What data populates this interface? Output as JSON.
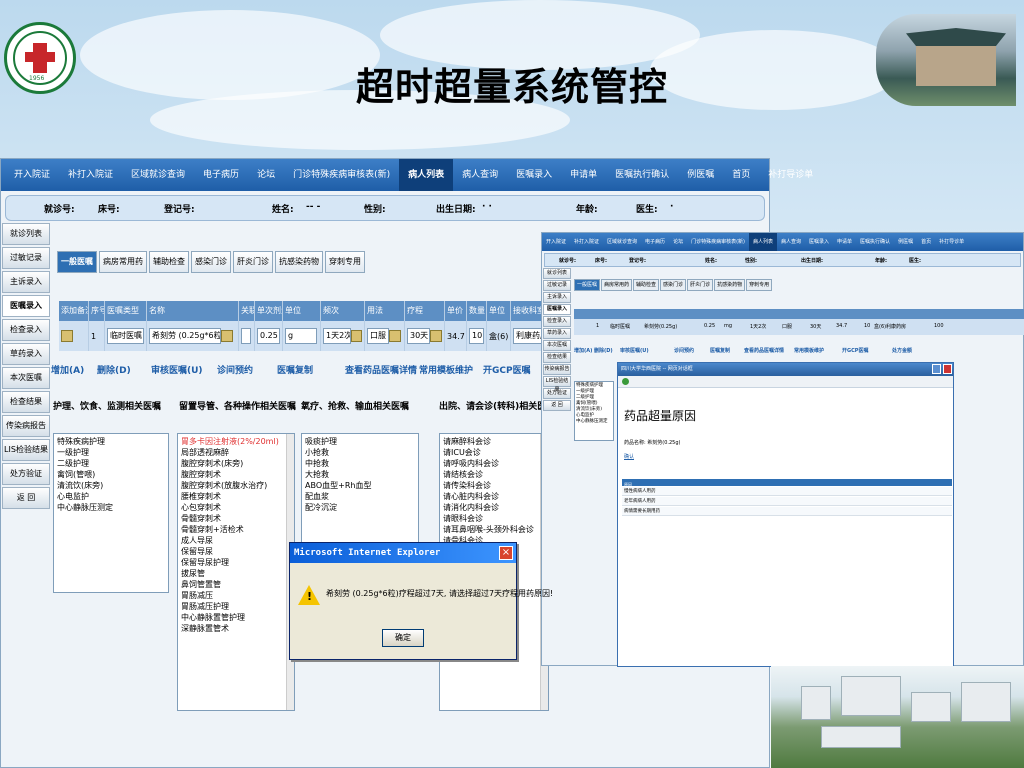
{
  "slide": {
    "title": "超时超量系统管控",
    "logo_text": "1956"
  },
  "app": {
    "nav": [
      "开入院证",
      "补打入院证",
      "区域就诊查询",
      "电子病历",
      "论坛",
      "门诊特殊疾病审核表(新)",
      "病人列表",
      "病人查询",
      "医嘱录入",
      "申请单",
      "医嘱执行确认",
      "例医嘱",
      "首页",
      "补打导诊单"
    ],
    "nav_active_index": 6,
    "info": {
      "clinic_no_label": "就诊号:",
      "bed_label": "床号:",
      "reg_label": "登记号:",
      "name_label": "姓名:",
      "name_value": "-- -",
      "sex_label": "性别:",
      "dob_label": "出生日期:",
      "dob_value": "· ·",
      "age_label": "年龄:",
      "doctor_label": "医生:",
      "doctor_value": "·"
    },
    "left_menu": [
      "就诊列表",
      "过敏记录",
      "主诉录入",
      "医嘱录入",
      "检查录入",
      "草药录入",
      "本次医嘱",
      "检查结果",
      "传染病报告",
      "LIS检验结果",
      "处方验证",
      "返 回"
    ],
    "left_menu_selected": 3,
    "tabs": [
      "一般医嘱",
      "病房常用药",
      "辅助检查",
      "感染门诊",
      "肝炎门诊",
      "抗感染药物",
      "穿刺专用"
    ],
    "grid_headers": [
      "添加备注",
      "序号",
      "医嘱类型",
      "名称",
      "关联",
      "单次剂量",
      "单位",
      "频次",
      "用法",
      "疗程",
      "单价",
      "数量",
      "单位",
      "接收科室"
    ],
    "row": {
      "seq": "1",
      "type": "临时医嘱",
      "name": "希刻劳 (0.25g*6粒)",
      "dose": "0.25",
      "unit": "g",
      "freq": "1天2次",
      "route": "口服",
      "course": "30天",
      "price": "34.7",
      "qty": "10",
      "pack": "盒(6)",
      "dept": "利康药房"
    },
    "ops": [
      "增加(A)",
      "删除(D)",
      "审核医嘱(U)",
      "诊间预约",
      "医嘱复制",
      "查看药品医嘱详情",
      "常用模板维护",
      "开GCP医嘱"
    ],
    "col_headers": [
      "护理、饮食、监测相关医嘱",
      "留置导管、各种操作相关医嘱",
      "氧疗、抢救、输血相关医嘱",
      "出院、请会诊(转科)相关医嘱"
    ],
    "list1": [
      "特殊疾病护理",
      "一级护理",
      "二级护理",
      "禽饲(管喂)",
      "清流饮(床旁)",
      "心电监护",
      "中心静脉压测定"
    ],
    "list2": [
      "胃多卡因注射液(2%/20ml)",
      "局部透视麻醉",
      "腹腔穿刺术(床旁)",
      "腹腔穿刺术",
      "腹腔穿刺术(放腹水治疗)",
      "腰椎穿刺术",
      "心包穿刺术",
      "骨髓穿刺术",
      "骨髓穿刺+活检术",
      "成人导尿",
      "保留导尿",
      "保留导尿护理",
      "拔尿管",
      "鼻饲管置管",
      "胃肠减压",
      "胃肠减压护理",
      "中心静脉置管护理",
      "深静脉置管术"
    ],
    "list3": [
      "吸痰护理",
      "小抢救",
      "中抢救",
      "大抢救",
      "ABO血型+Rh血型",
      "配血浆",
      "配冷沉淀"
    ],
    "list4": [
      "请麻醉科会诊",
      "请ICU会诊",
      "请呼吸内科会诊",
      "请结核会诊",
      "请传染科会诊",
      "请心脏内科会诊",
      "请消化内科会诊",
      "请眼科会诊",
      "请耳鼻咽喉-头颈外科会诊",
      "请骨科会诊"
    ]
  },
  "dialog": {
    "title": "Microsoft Internet Explorer",
    "message": "希刻劳 (0.25g*6粒)疗程超过7天, 请选择超过7天疗程用药原因!",
    "ok": "确定"
  },
  "app2": {
    "nav": [
      "开入院证",
      "补打入院证",
      "区域就诊查询",
      "电子病历",
      "论坛",
      "门诊特殊疾病审核表(新)",
      "病人列表",
      "病人查询",
      "医嘱录入",
      "申请单",
      "医嘱执行确认",
      "例医嘱",
      "首页",
      "补打导诊单"
    ],
    "info": [
      "就诊号:",
      "床号:",
      "登记号:",
      "姓名:",
      "性别:",
      "出生日期:",
      "年龄:",
      "医生:"
    ],
    "left_menu": [
      "就诊列表",
      "过敏记录",
      "主诉录入",
      "医嘱录入",
      "检查录入",
      "草药录入",
      "本次医嘱",
      "检查结果",
      "传染病报告",
      "LIS检验结果",
      "处方验证",
      "返 回"
    ],
    "tabs": [
      "一般医嘱",
      "病房常用药",
      "辅助检查",
      "感染门诊",
      "肝炎门诊",
      "抗感染药物",
      "穿刺专用"
    ],
    "row_items": [
      "1",
      "临时医嘱",
      "希刻劳(0.25g)",
      "0.25",
      "mg",
      "1天2次",
      "口服",
      "30天",
      "34.7",
      "10",
      "盒(6)",
      "利康药房",
      "100"
    ],
    "ops": [
      "增加(A)",
      "删除(D)",
      "审核医嘱(U)",
      "诊间预约",
      "医嘱复制",
      "查看药品医嘱详情",
      "常用模板维护",
      "开GCP医嘱",
      "处方金额"
    ],
    "list": [
      "特殊疾病护理",
      "一级护理",
      "二级护理",
      "禽饲(管喂)",
      "清流饮(床旁)",
      "心电监护",
      "中心静脉压测定"
    ],
    "popup_title": "四川大学华西医院 -- 网页对话框",
    "popup_heading": "药品超量原因",
    "popup_drug": "药品名称: 希刻劳(0.25g)",
    "popup_link": "确认",
    "popup_list_header": "原因",
    "reasons": [
      "慢性病病人用药",
      "老年病病人用药",
      "病情需要长期用药"
    ]
  }
}
